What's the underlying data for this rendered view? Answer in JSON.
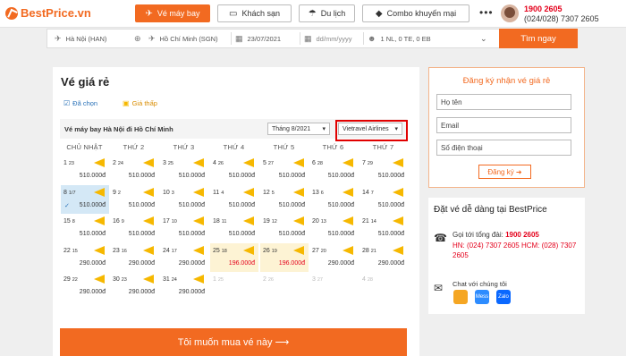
{
  "header": {
    "logo": "BestPrice.vn",
    "nav": [
      {
        "label": "Vé máy bay",
        "icon": "plane-icon"
      },
      {
        "label": "Khách sạn",
        "icon": "bed-icon"
      },
      {
        "label": "Du lịch",
        "icon": "beach-icon"
      },
      {
        "label": "Combo khuyến mại",
        "icon": "tag-icon"
      }
    ],
    "more": "•••",
    "hotline": "1900 2605",
    "hotline2": "(024/028) 7307 2605"
  },
  "search": {
    "from": "Hà Nội (HAN)",
    "to": "Hồ Chí Minh (SGN)",
    "depart": "23/07/2021",
    "return_placeholder": "dd/mm/yyyy",
    "passengers": "1 NL, 0 TE, 0 EB",
    "button": "Tìm ngay"
  },
  "main": {
    "title": "Vé giá rẻ",
    "legend_selected": "Đã chọn",
    "legend_cheap": "Giá thấp",
    "subtitle": "Vé máy bay Hà Nội đi Hồ Chí Minh",
    "month": "Tháng 8/2021",
    "airline": "Vietravel Airlines",
    "days": [
      "CHỦ NHẬT",
      "THỨ 2",
      "THỨ 3",
      "THỨ 4",
      "THỨ 5",
      "THỨ 6",
      "THỨ 7"
    ],
    "weeks": [
      [
        {
          "d": "1",
          "l": "23",
          "p": "510.000đ"
        },
        {
          "d": "2",
          "l": "24",
          "p": "510.000đ"
        },
        {
          "d": "3",
          "l": "25",
          "p": "510.000đ"
        },
        {
          "d": "4",
          "l": "26",
          "p": "510.000đ"
        },
        {
          "d": "5",
          "l": "27",
          "p": "510.000đ"
        },
        {
          "d": "6",
          "l": "28",
          "p": "510.000đ"
        },
        {
          "d": "7",
          "l": "29",
          "p": "510.000đ"
        }
      ],
      [
        {
          "d": "8",
          "l": "1/7",
          "p": "510.000đ",
          "s": "sel"
        },
        {
          "d": "9",
          "l": "2",
          "p": "510.000đ"
        },
        {
          "d": "10",
          "l": "3",
          "p": "510.000đ"
        },
        {
          "d": "11",
          "l": "4",
          "p": "510.000đ"
        },
        {
          "d": "12",
          "l": "5",
          "p": "510.000đ"
        },
        {
          "d": "13",
          "l": "6",
          "p": "510.000đ"
        },
        {
          "d": "14",
          "l": "7",
          "p": "510.000đ"
        }
      ],
      [
        {
          "d": "15",
          "l": "8",
          "p": "510.000đ"
        },
        {
          "d": "16",
          "l": "9",
          "p": "510.000đ"
        },
        {
          "d": "17",
          "l": "10",
          "p": "510.000đ"
        },
        {
          "d": "18",
          "l": "11",
          "p": "510.000đ"
        },
        {
          "d": "19",
          "l": "12",
          "p": "510.000đ"
        },
        {
          "d": "20",
          "l": "13",
          "p": "510.000đ"
        },
        {
          "d": "21",
          "l": "14",
          "p": "510.000đ"
        }
      ],
      [
        {
          "d": "22",
          "l": "15",
          "p": "290.000đ"
        },
        {
          "d": "23",
          "l": "16",
          "p": "290.000đ"
        },
        {
          "d": "24",
          "l": "17",
          "p": "290.000đ"
        },
        {
          "d": "25",
          "l": "18",
          "p": "196.000đ",
          "s": "cheap"
        },
        {
          "d": "26",
          "l": "19",
          "p": "196.000đ",
          "s": "cheap"
        },
        {
          "d": "27",
          "l": "20",
          "p": "290.000đ"
        },
        {
          "d": "28",
          "l": "21",
          "p": "290.000đ"
        }
      ],
      [
        {
          "d": "29",
          "l": "22",
          "p": "290.000đ"
        },
        {
          "d": "30",
          "l": "23",
          "p": "290.000đ"
        },
        {
          "d": "31",
          "l": "24",
          "p": "290.000đ"
        },
        {
          "d": "1",
          "l": "25",
          "p": "",
          "s": "past"
        },
        {
          "d": "2",
          "l": "26",
          "p": "",
          "s": "past"
        },
        {
          "d": "3",
          "l": "27",
          "p": "",
          "s": "past"
        },
        {
          "d": "4",
          "l": "28",
          "p": "",
          "s": "past"
        }
      ]
    ],
    "buy": "Tôi muốn mua vé này  ⟶"
  },
  "subscribe": {
    "title": "Đăng ký nhận vé giá rẻ",
    "name_ph": "Họ tên",
    "email_ph": "Email",
    "phone_ph": "Số điện thoại",
    "button": "Đăng ký ➜"
  },
  "info": {
    "title": "Đặt vé dễ dàng tại BestPrice",
    "hotline_label": "Gọi tới tổng đài: ",
    "hotline": "1900 2605",
    "offices": "HN: (024) 7307 2605 HCM: (028) 7307 2605",
    "chat_label": "Chat với chúng tôi",
    "chat_apps": [
      "Mess",
      "Zalo"
    ]
  },
  "colors": {
    "brand": "#f26a21",
    "highlight": "#e10000",
    "selected": "#d4e8f6",
    "cheap": "#fdf3d4",
    "flag": "#f6b800"
  }
}
